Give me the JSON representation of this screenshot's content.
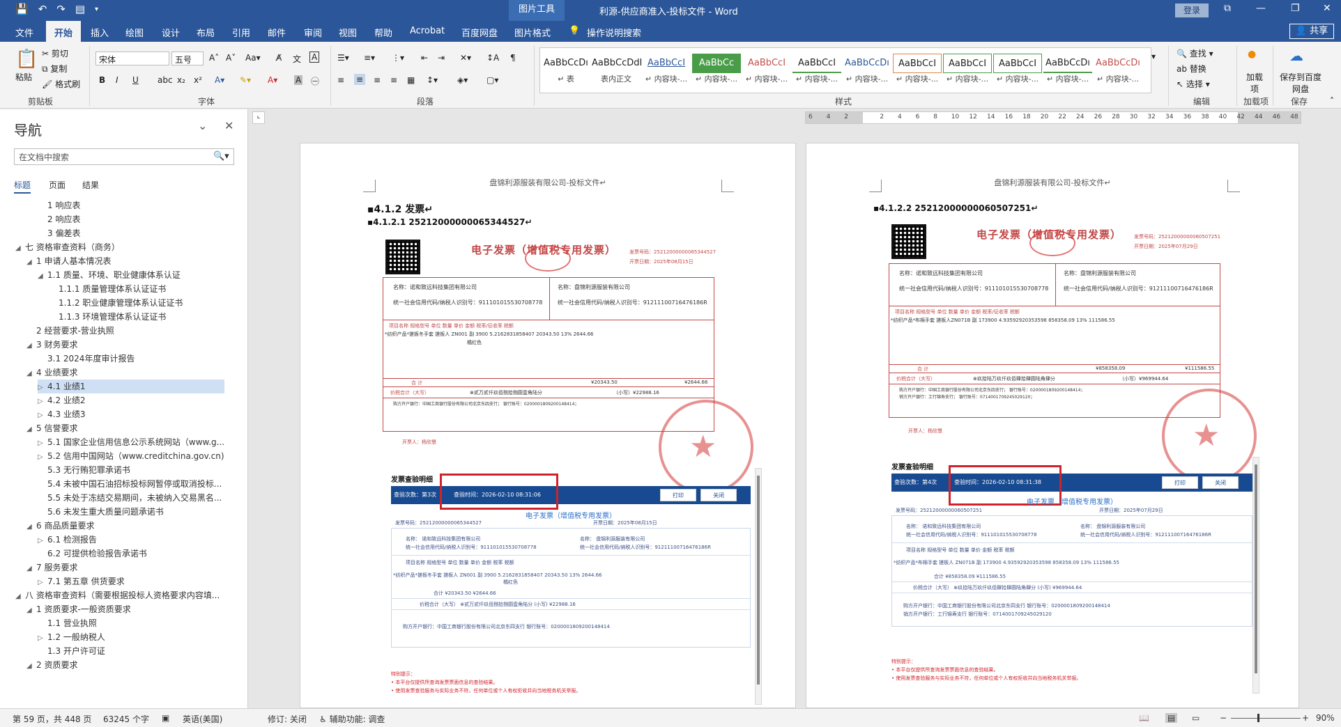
{
  "titlebar": {
    "context_tab": "图片工具",
    "title": "利源-供应商准入-投标文件 - Word",
    "login": "登录"
  },
  "tabs": [
    "文件",
    "开始",
    "插入",
    "绘图",
    "设计",
    "布局",
    "引用",
    "邮件",
    "审阅",
    "视图",
    "帮助",
    "Acrobat",
    "百度网盘",
    "图片格式"
  ],
  "active_tab": "开始",
  "tell_me": "操作说明搜索",
  "share": "共享",
  "ribbon": {
    "clipboard": {
      "paste": "粘贴",
      "cut": "剪切",
      "copy": "复制",
      "format_painter": "格式刷",
      "label": "剪贴板"
    },
    "font": {
      "name": "宋体",
      "size": "五号",
      "label": "字体"
    },
    "paragraph": {
      "label": "段落"
    },
    "styles": {
      "label": "样式",
      "items": [
        {
          "sample": "AaBbCcDı",
          "name": "↵ 表"
        },
        {
          "sample": "AaBbCcDdI",
          "name": "表内正文"
        },
        {
          "sample": "AaBbCcI",
          "name": "↵ 内容块-..."
        },
        {
          "sample": "AaBbCc",
          "name": "↵ 内容块-..."
        },
        {
          "sample": "AaBbCcI",
          "name": "↵ 内容块-..."
        },
        {
          "sample": "AaBbCcI",
          "name": "↵ 内容块-..."
        },
        {
          "sample": "AaBbCcDı",
          "name": "↵ 内容块-..."
        },
        {
          "sample": "AaBbCcI",
          "name": "↵ 内容块-..."
        },
        {
          "sample": "AaBbCcI",
          "name": "↵ 内容块-..."
        },
        {
          "sample": "AaBbCcI",
          "name": "↵ 内容块-..."
        },
        {
          "sample": "AaBbCcDı",
          "name": "↵ 内容块-..."
        },
        {
          "sample": "AaBbCcDı",
          "name": "↵ 内容块-..."
        }
      ]
    },
    "editing": {
      "find": "查找",
      "replace": "替换",
      "select": "选择",
      "label": "编辑"
    },
    "addin": {
      "load": "加载项",
      "label": "加载项"
    },
    "save": {
      "baidu": "保存到百度网盘",
      "label": "保存"
    }
  },
  "nav": {
    "title": "导航",
    "search_placeholder": "在文档中搜索",
    "tabs": [
      "标题",
      "页面",
      "结果"
    ],
    "items": [
      {
        "text": "1 响应表",
        "arrow": ""
      },
      {
        "text": "2 响应表",
        "arrow": ""
      },
      {
        "text": "3 偏差表",
        "arrow": ""
      },
      {
        "text": "七 资格审查资料（商务）",
        "arrow": "◢"
      },
      {
        "text": "1 申请人基本情况表",
        "arrow": "◢"
      },
      {
        "text": "1.1 质量、环境、职业健康体系认证",
        "arrow": "◢"
      },
      {
        "text": "1.1.1 质量管理体系认证证书",
        "arrow": ""
      },
      {
        "text": "1.1.2 职业健康管理体系认证证书",
        "arrow": ""
      },
      {
        "text": "1.1.3 环境管理体系认证证书",
        "arrow": ""
      },
      {
        "text": "2 经营要求-营业执照",
        "arrow": ""
      },
      {
        "text": "3 财务要求",
        "arrow": "◢"
      },
      {
        "text": "3.1 2024年度审计报告",
        "arrow": ""
      },
      {
        "text": "4 业绩要求",
        "arrow": "◢"
      },
      {
        "text": "4.1 业绩1",
        "arrow": "▷"
      },
      {
        "text": "4.2 业绩2",
        "arrow": "▷"
      },
      {
        "text": "4.3 业绩3",
        "arrow": "▷"
      },
      {
        "text": "5 信誉要求",
        "arrow": "◢"
      },
      {
        "text": "5.1 国家企业信用信息公示系统网站（www.g...",
        "arrow": "▷"
      },
      {
        "text": "5.2 信用中国网站（www.creditchina.gov.cn)",
        "arrow": "▷"
      },
      {
        "text": "5.3 无行贿犯罪承诺书",
        "arrow": ""
      },
      {
        "text": "5.4 未被中国石油招标投标网暂停或取消投标...",
        "arrow": ""
      },
      {
        "text": "5.5 未处于冻结交易期间，未被纳入交易黑名...",
        "arrow": ""
      },
      {
        "text": "5.6 未发生重大质量问题承诺书",
        "arrow": ""
      },
      {
        "text": "6 商品质量要求",
        "arrow": "◢"
      },
      {
        "text": "6.1 检测报告",
        "arrow": "▷"
      },
      {
        "text": "6.2 可提供检验报告承诺书",
        "arrow": ""
      },
      {
        "text": "7 服务要求",
        "arrow": "◢"
      },
      {
        "text": "7.1 第五章 供货要求",
        "arrow": "▷"
      },
      {
        "text": "八 资格审查资料（需要根据投标人资格要求内容填...",
        "arrow": "◢"
      },
      {
        "text": "1 资质要求-一般资质要求",
        "arrow": "◢"
      },
      {
        "text": "1.1 营业执照",
        "arrow": ""
      },
      {
        "text": "1.2 一般纳税人",
        "arrow": "▷"
      },
      {
        "text": "1.3 开户许可证",
        "arrow": ""
      },
      {
        "text": "2 资质要求",
        "arrow": "◢"
      }
    ],
    "selected_index": 13
  },
  "ruler_labels": [
    "6",
    "4",
    "2",
    "",
    "2",
    "4",
    "6",
    "8",
    "10",
    "12",
    "14",
    "16",
    "18",
    "20",
    "22",
    "24",
    "26",
    "28",
    "30",
    "32",
    "34",
    "36",
    "38",
    "40",
    "42",
    "44",
    "46",
    "48"
  ],
  "pages": [
    {
      "header": "盘锦利源服装有限公司-投标文件↵",
      "heading": "▪4.1.2  发票↵",
      "subheading": "▪4.1.2.1    25212000000065344527↵",
      "invoice": {
        "title": "电子发票（增值税专用发票）",
        "number_label": "发票号码：25212000000065344527",
        "date_label": "开票日期：2025年08月15日",
        "buyer_name": "名称：诺和致远科技集团有限公司",
        "buyer_tax": "统一社会信用代码/纳税人识别号：911101015530708778",
        "seller_name": "名称：盘锦利源服装有限公司",
        "seller_tax": "统一社会信用代码/纳税人识别号：91211100716476186R",
        "item_header": "项目名称      规格型号     单位      数量       单价       金额      税率/征收率      税额",
        "item_row": "*纺织产品*搓板冬手套   搓板人 ZN001   副       3900  5.2162831858407    20343.50     13%        2644.66",
        "item_row2": "橘红色",
        "total_amount": "¥20343.50",
        "total_tax": "¥2644.66",
        "total_label": "合        计",
        "total_words_label": "价税合计（大写）",
        "total_words": "⊗贰万贰仟玖佰捌拾捌圆壹角陆分",
        "total_small": "（小写）¥22988.16",
        "remark": "购方开户银行：中国工商银行股份有限公司北京东四支行；   银行账号：0200001809200148414；",
        "issuer": "开票人：杨欣慧"
      },
      "verify": {
        "title": "发票查验明细",
        "count": "查验次数：第3次",
        "time": "查验时间：2026-02-10 08:31:06",
        "print": "打印",
        "close": "关闭",
        "etitle": "电子发票（增值税专用发票）",
        "num": "发票号码：25212000000065344527",
        "date": "开票日期：2025年08月15日",
        "buyer": "名称：                   诺和致远科技集团有限公司",
        "buyer_tax": "统一社会信用代码/纳税人识别号：911101015530708778",
        "seller": "名称：                   盘锦利源服装有限公司",
        "seller_tax": "统一社会信用代码/纳税人识别号：91211100716476186R",
        "cols": "项目名称                规格型号     单位     数量        单价           金额         税率        税额",
        "row": "*纺织产品*搓板冬手套        搓板人 ZN001  副      3900   5.2162831858407    20343.50     13%       2644.66",
        "row2": "橘红色",
        "sum": "合计                                                                      ¥20343.50              ¥2644.66",
        "words": "价税合计（大写）         ⊗贰万贰仟玖佰捌拾捌圆壹角陆分                (小写)    ¥22988.16",
        "bank": "购方开户银行：中国工商银行股份有限公司北京东四支行  银行账号：0200001809200148414",
        "note_title": "特别提示：",
        "note1": "• 本平台仅提供所查询发票票面信息的查验结果。",
        "note2": "• 使用发票查验服务与实际业务不符，任何单位或个人有权拒收并向当地税务机关举报。"
      }
    },
    {
      "header": "盘锦利源服装有限公司-投标文件↵",
      "heading": "▪4.1.2.2     25212000000060507251↵",
      "invoice": {
        "title": "电子发票（增值税专用发票）",
        "number_label": "发票号码：25212000000060507251",
        "date_label": "开票日期：2025年07月29日",
        "buyer_name": "名称：诺和致远科技集团有限公司",
        "buyer_tax": "统一社会信用代码/纳税人识别号：911101015530708778",
        "seller_name": "名称：盘锦利源服装有限公司",
        "seller_tax": "统一社会信用代码/纳税人识别号：91211100716476186R",
        "item_header": "项目名称      规格型号     单位      数量       单价       金额      税率/征收率      税额",
        "item_row": "*纺织产品*布棉手套   搓板人ZN071B   副      173900  4.93592920353598    858358.09     13%       111586.55",
        "total_amount": "¥858358.09",
        "total_tax": "¥111586.55",
        "total_label": "合        计",
        "total_words_label": "价税合计（大写）",
        "total_words": "⊗玖拾陆万玖仟玖佰肆拾肆圆陆角肆分",
        "total_small": "（小写）¥969944.64",
        "remark": "购方开户银行：中国工商银行股份有限公司北京东四支行；   银行账号：0200001809200148414；",
        "remark2": "销方开户银行：工行锦寿支行；                    银行账号：0714001709245029120；",
        "issuer": "开票人：杨欣慧"
      },
      "verify": {
        "title": "发票查验明细",
        "count": "查验次数：第4次",
        "time": "查验时间：2026-02-10 08:31:38",
        "print": "打印",
        "close": "关闭",
        "etitle": "电子发票（增值税专用发票）",
        "num": "发票号码：25212000000060507251",
        "date": "开票日期：2025年07月29日",
        "buyer": "名称：                   诺和致远科技集团有限公司",
        "buyer_tax": "统一社会信用代码/纳税人识别号：911101015530708778",
        "seller": "名称：                   盘锦利源服装有限公司",
        "seller_tax": "统一社会信用代码/纳税人识别号：91211100716476186R",
        "cols": "项目名称                规格型号     单位     数量        单价           金额         税率        税额",
        "row": "*纺织产品*布棉手套          搓板人 ZN071B  副     173900  4.93592920353598   858358.09     13%      111586.55",
        "sum": "合计                                                                     ¥858358.09             ¥111586.55",
        "words": "价税合计（大写）       ⊗玖拾陆万玖仟玖佰肆拾肆圆陆角肆分              (小写)    ¥969944.64",
        "bank": "购方开户银行：中国工商银行股份有限公司北京东四支行  银行账号：0200001809200148414",
        "bank2": "销方开户银行：工行锦寿支行  银行账号：0714001709245029120",
        "note_title": "特别提示：",
        "note1": "• 本平台仅提供所查询发票票面信息的查验结果。",
        "note2": "• 使用发票查验服务与实际业务不符，任何单位或个人有权拒收并向当地税务机关举报。"
      }
    }
  ],
  "status": {
    "page": "第 59 页，共 448 页",
    "words": "63245 个字",
    "lang": "英语(美国)",
    "track": "修订: 关闭",
    "access": "辅助功能: 调查",
    "zoom": "90%"
  }
}
